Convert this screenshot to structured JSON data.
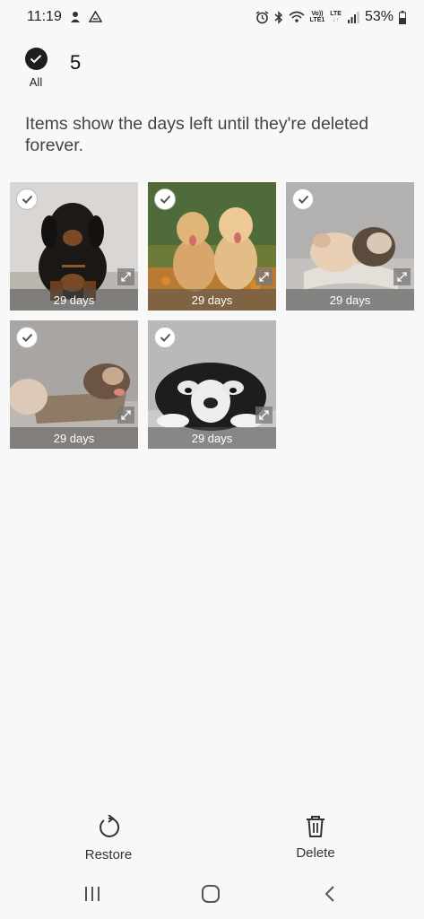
{
  "status_bar": {
    "time": "11:19",
    "battery": "53%",
    "volte": "Vo))",
    "lte1": "LTE1",
    "lte": "LTE",
    "icons": [
      "drive-icon",
      "alarm-icon",
      "bluetooth-icon",
      "wifi-icon",
      "signal-icon",
      "battery-icon"
    ]
  },
  "selection": {
    "all_label": "All",
    "count": "5"
  },
  "info_text": "Items show the days left until they're deleted forever.",
  "items": [
    {
      "days": "29 days",
      "subject": "black-tan-puppy"
    },
    {
      "days": "29 days",
      "subject": "two-golden-puppies"
    },
    {
      "days": "29 days",
      "subject": "sleeping-puppies"
    },
    {
      "days": "29 days",
      "subject": "puppies-in-basket"
    },
    {
      "days": "29 days",
      "subject": "husky-puppy"
    }
  ],
  "actions": {
    "restore_label": "Restore",
    "delete_label": "Delete"
  },
  "colors": {
    "background": "#f8f8f8",
    "dark_check": "#1e1e1e",
    "overlay": "#505050"
  }
}
